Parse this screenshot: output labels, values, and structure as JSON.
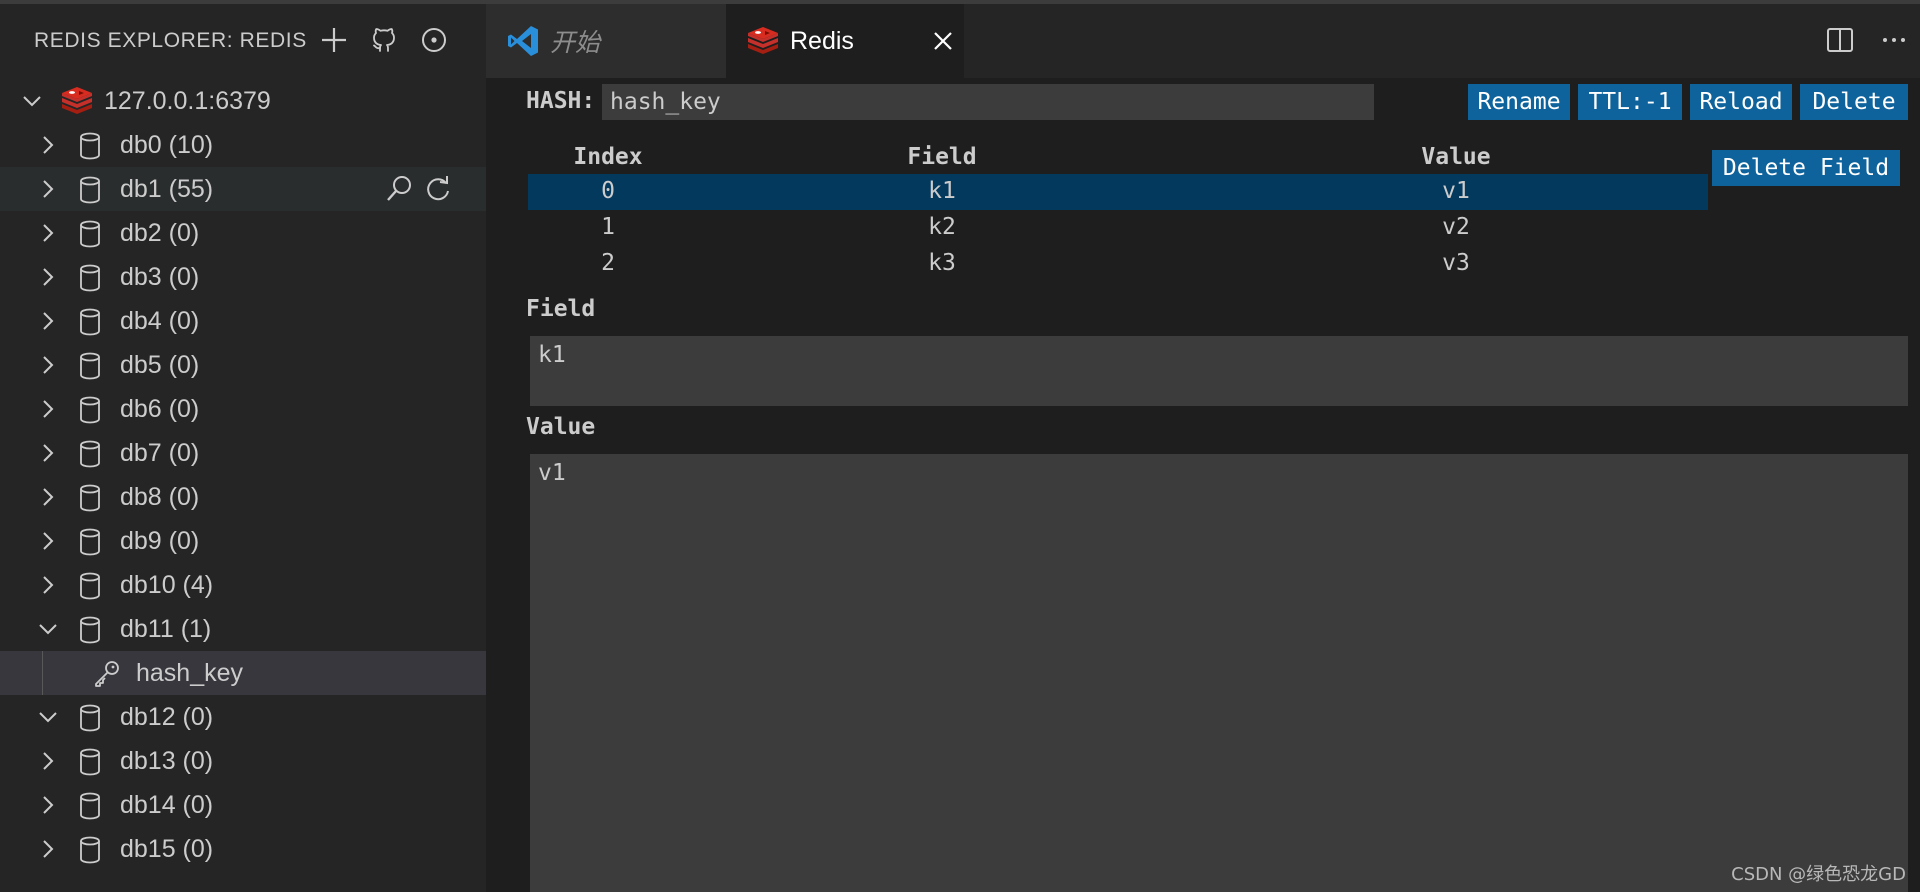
{
  "colors": {
    "sidebar_bg": "#252526",
    "editor_bg": "#1e1e1e",
    "button_bg": "#0e639c",
    "selected_row_bg": "#04395e",
    "redis_red": "#d82c20",
    "vscode_blue": "#2a8fdb"
  },
  "sidebar": {
    "title": "REDIS EXPLORER: REDIS",
    "actions": [
      "add-icon",
      "github-icon",
      "info-icon"
    ],
    "server": {
      "label": "127.0.0.1:6379",
      "icon": "redis-icon"
    },
    "databases": [
      {
        "label": "db0 (10)",
        "expanded": false
      },
      {
        "label": "db1 (55)",
        "expanded": false
      },
      {
        "label": "db2 (0)",
        "expanded": false
      },
      {
        "label": "db3 (0)",
        "expanded": false
      },
      {
        "label": "db4 (0)",
        "expanded": false
      },
      {
        "label": "db5 (0)",
        "expanded": false
      },
      {
        "label": "db6 (0)",
        "expanded": false
      },
      {
        "label": "db7 (0)",
        "expanded": false
      },
      {
        "label": "db8 (0)",
        "expanded": false
      },
      {
        "label": "db9 (0)",
        "expanded": false
      },
      {
        "label": "db10 (4)",
        "expanded": false
      },
      {
        "label": "db11 (1)",
        "expanded": true,
        "keys": [
          "hash_key"
        ]
      },
      {
        "label": "db12 (0)",
        "expanded": true
      },
      {
        "label": "db13 (0)",
        "expanded": false
      },
      {
        "label": "db14 (0)",
        "expanded": false
      },
      {
        "label": "db15 (0)",
        "expanded": false
      }
    ]
  },
  "tabs": [
    {
      "label": "开始",
      "active": false
    },
    {
      "label": "Redis",
      "active": true
    }
  ],
  "editor": {
    "type_label": "HASH:",
    "key_value": "hash_key",
    "buttons": {
      "rename": "Rename",
      "ttl": "TTL:-1",
      "reload": "Reload",
      "delete": "Delete",
      "delete_field": "Delete Field"
    },
    "table": {
      "headers": [
        "Index",
        "Field",
        "Value"
      ],
      "rows": [
        {
          "index": "0",
          "field": "k1",
          "value": "v1",
          "selected": true
        },
        {
          "index": "1",
          "field": "k2",
          "value": "v2",
          "selected": false
        },
        {
          "index": "2",
          "field": "k3",
          "value": "v3",
          "selected": false
        }
      ]
    },
    "field_label": "Field",
    "field_value": "k1",
    "value_label": "Value",
    "value_value": "v1"
  },
  "watermark": "CSDN @绿色恐龙GD"
}
